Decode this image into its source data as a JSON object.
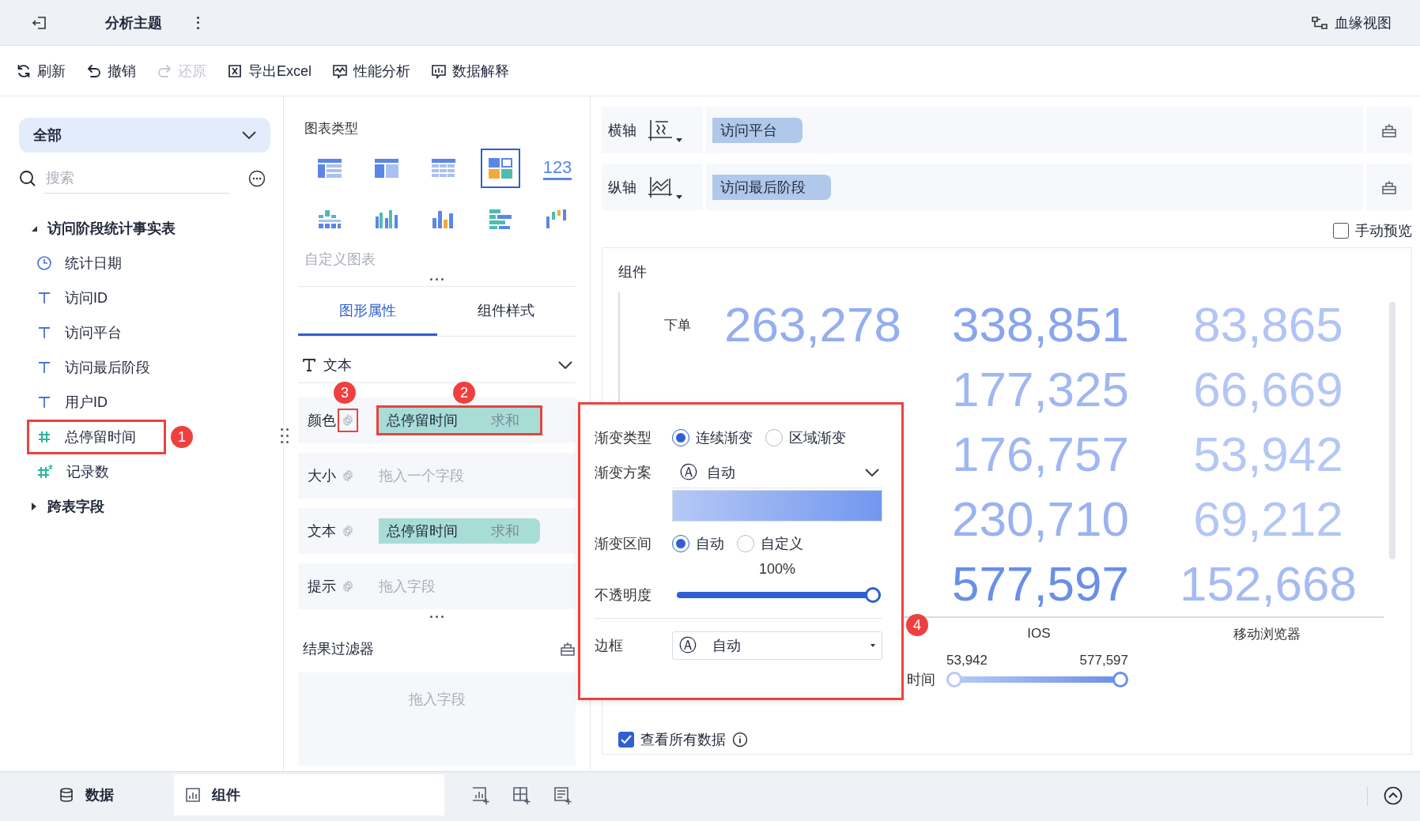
{
  "header": {
    "title": "分析主题",
    "lineage_button": "血缘视图"
  },
  "toolbar": [
    {
      "label": "刷新",
      "kind": "refresh",
      "disabled": false
    },
    {
      "label": "撤销",
      "kind": "undo",
      "disabled": false
    },
    {
      "label": "还原",
      "kind": "redo",
      "disabled": true
    },
    {
      "label": "导出Excel",
      "kind": "excel",
      "disabled": false
    },
    {
      "label": "性能分析",
      "kind": "performance",
      "disabled": false
    },
    {
      "label": "数据解释",
      "kind": "explain",
      "disabled": false
    }
  ],
  "fields_panel": {
    "dataset_select": "全部",
    "search": {
      "placeholder": "搜索"
    },
    "tree": [
      {
        "label": "访问阶段统计事实表",
        "expanded": true,
        "children": [
          {
            "label": "统计日期",
            "kind": "date"
          },
          {
            "label": "访问ID",
            "kind": "text"
          },
          {
            "label": "访问平台",
            "kind": "text"
          },
          {
            "label": "访问最后阶段",
            "kind": "text"
          },
          {
            "label": "用户ID",
            "kind": "text"
          },
          {
            "label": "总停留时间",
            "kind": "number",
            "annotation": "1"
          },
          {
            "label": "记录数",
            "kind": "count"
          }
        ]
      },
      {
        "label": "跨表字段",
        "expanded": false
      }
    ]
  },
  "chart_types": {
    "title": "图表类型",
    "items": [
      {
        "kind": "table",
        "selected": false
      },
      {
        "kind": "cross-table",
        "selected": false
      },
      {
        "kind": "detail-table",
        "selected": false
      },
      {
        "kind": "text-grid",
        "selected": true
      },
      {
        "kind": "kpi",
        "label": "123",
        "selected": false
      },
      {
        "kind": "dot-bars",
        "selected": false
      },
      {
        "kind": "grouped-bars",
        "selected": false
      },
      {
        "kind": "bars",
        "selected": false
      },
      {
        "kind": "bar-rows",
        "selected": false
      },
      {
        "kind": "floating-bars",
        "selected": false
      }
    ],
    "custom_label": "自定义图表"
  },
  "property_tabs": [
    {
      "label": "图形属性",
      "selected": true
    },
    {
      "label": "组件样式",
      "selected": false
    }
  ],
  "marks": {
    "section": "文本",
    "rows": [
      {
        "label": "颜色",
        "field": {
          "name": "总停留时间",
          "aggregation": "求和"
        },
        "gear_annotation": "3",
        "field_annotation": "2"
      },
      {
        "label": "大小",
        "placeholder": "拖入一个字段"
      },
      {
        "label": "文本",
        "field": {
          "name": "总停留时间",
          "aggregation": "求和"
        }
      },
      {
        "label": "提示",
        "placeholder": "拖入字段"
      }
    ]
  },
  "result_filter": {
    "title": "结果过滤器",
    "placeholder": "拖入字段"
  },
  "axes": [
    {
      "label": "横轴",
      "kind": "x",
      "field": "访问平台"
    },
    {
      "label": "纵轴",
      "kind": "y",
      "field": "访问最后阶段"
    }
  ],
  "manual_preview": {
    "label": "手动预览",
    "checked": false
  },
  "component": {
    "title": "组件",
    "rows": [
      {
        "label": "下单",
        "cells": [
          {
            "value": "263,278",
            "color": "#94aef0"
          },
          {
            "value": "338,851",
            "color": "#88a5ee"
          },
          {
            "value": "83,865",
            "color": "#b1c4f5"
          }
        ]
      },
      {
        "cells": [
          null,
          {
            "value": "177,325",
            "color": "#a0b7f2"
          },
          {
            "value": "66,669",
            "color": "#b3c6f5"
          }
        ]
      },
      {
        "cells": [
          null,
          {
            "value": "176,757",
            "color": "#a0b7f2"
          },
          {
            "value": "53,942",
            "color": "#b5c7f5"
          }
        ]
      },
      {
        "cells": [
          null,
          {
            "value": "230,710",
            "color": "#9ab2f1"
          },
          {
            "value": "69,212",
            "color": "#b3c6f5"
          }
        ]
      },
      {
        "cells": [
          null,
          {
            "value": "577,597",
            "color": "#6a8fe8"
          },
          {
            "value": "152,668",
            "color": "#a5bbf3"
          }
        ]
      }
    ],
    "column_labels": [
      "IOS",
      "移动浏览器"
    ],
    "legend": {
      "label": "时间",
      "min": "53,942",
      "max": "577,597"
    },
    "view_all": {
      "label": "查看所有数据",
      "checked": true
    }
  },
  "gradient_popup": {
    "annotation": "4",
    "type": {
      "label": "渐变类型",
      "options": [
        {
          "label": "连续渐变",
          "selected": true
        },
        {
          "label": "区域渐变",
          "selected": false
        }
      ]
    },
    "scheme": {
      "label": "渐变方案",
      "icon": "Ⓐ",
      "value": "自动"
    },
    "range": {
      "label": "渐变区间",
      "options": [
        {
          "label": "自动",
          "selected": true
        },
        {
          "label": "自定义",
          "selected": false
        }
      ]
    },
    "opacity": {
      "label": "不透明度",
      "reading": "100%",
      "level": 1
    },
    "border": {
      "label": "边框",
      "icon": "Ⓐ",
      "value": "自动"
    }
  },
  "bottom_tabs": [
    {
      "label": "数据",
      "kind": "data",
      "selected": false
    },
    {
      "label": "组件",
      "kind": "component",
      "selected": true
    }
  ]
}
